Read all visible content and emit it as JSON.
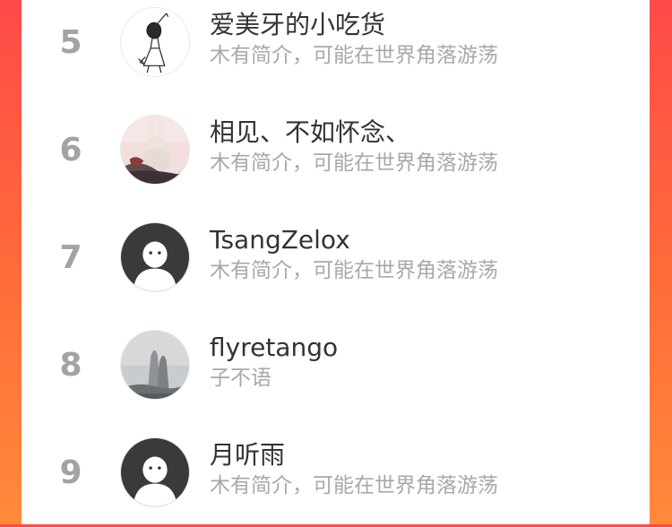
{
  "ranking": {
    "items": [
      {
        "rank": "5",
        "name": "爱美牙的小吃货",
        "bio": "木有简介，可能在世界角落游荡",
        "avatar": "sketch-girl-avatar"
      },
      {
        "rank": "6",
        "name": "相见、不如怀念、",
        "bio": "木有简介，可能在世界角落游荡",
        "avatar": "bunny-photo-avatar"
      },
      {
        "rank": "7",
        "name": "TsangZelox",
        "bio": "木有简介，可能在世界角落游荡",
        "avatar": "default-avatar"
      },
      {
        "rank": "8",
        "name": "flyretango",
        "bio": "子不语",
        "avatar": "misty-mountain-avatar"
      },
      {
        "rank": "9",
        "name": "月听雨",
        "bio": "木有简介，可能在世界角落游荡",
        "avatar": "default-avatar"
      }
    ]
  },
  "colors": {
    "rank": "#a3a3a3",
    "name": "#333333",
    "bio": "#a8a8a8",
    "default_avatar_bg": "#3a3a3a"
  }
}
